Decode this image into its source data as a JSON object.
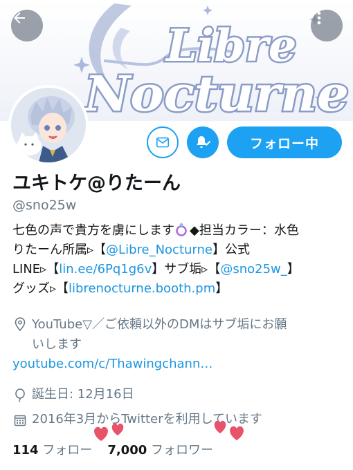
{
  "banner": {
    "logo_line1": "Libre",
    "logo_line2": "Nocturne"
  },
  "icons": {
    "back": "arrow-left-icon",
    "more": "more-vertical-icon",
    "mail": "envelope-icon",
    "notifications": "bell-check-icon",
    "location": "location-pin-icon",
    "birthday": "balloon-icon",
    "calendar": "calendar-icon",
    "hearts": "heart-icon",
    "ring": "ring-icon"
  },
  "colors": {
    "accent": "#1da1f2",
    "link": "#1b95e0",
    "muted": "#657786",
    "heart": "#e8536a"
  },
  "profile": {
    "display_name": "ユキトケ@りたーん",
    "handle": "@sno25w",
    "follow_label": "フォロー中"
  },
  "bio": {
    "line1_a": "七色の声で貴方を虜にします",
    "line1_b": "◆担当カラー：水色",
    "line2_a": "りたーん所属▹【",
    "line2_link": "@Libre_Nocturne",
    "line2_b": "】公式",
    "line3_a": "LINE▹【",
    "line3_link1": "lin.ee/6Pq1g6v",
    "line3_b": "】サブ垢▹【",
    "line3_link2": "@sno25w_",
    "line3_c": "】",
    "line4_a": "グッズ▹【",
    "line4_link": "librenocturne.booth.pm",
    "line4_b": "】"
  },
  "meta": {
    "location_line1": "YouTube▽／ご依頼以外のDMはサブ垢にお願",
    "location_line2": "いします",
    "url": "youtube.com/c/Thawingchann…",
    "birthday": "誕生日: 12月16日",
    "joined": "2016年3月からTwitterを利用しています"
  },
  "stats": {
    "following_count": "114",
    "following_label": "フォロー",
    "followers_count": "7,000",
    "followers_label": "フォロワー"
  }
}
